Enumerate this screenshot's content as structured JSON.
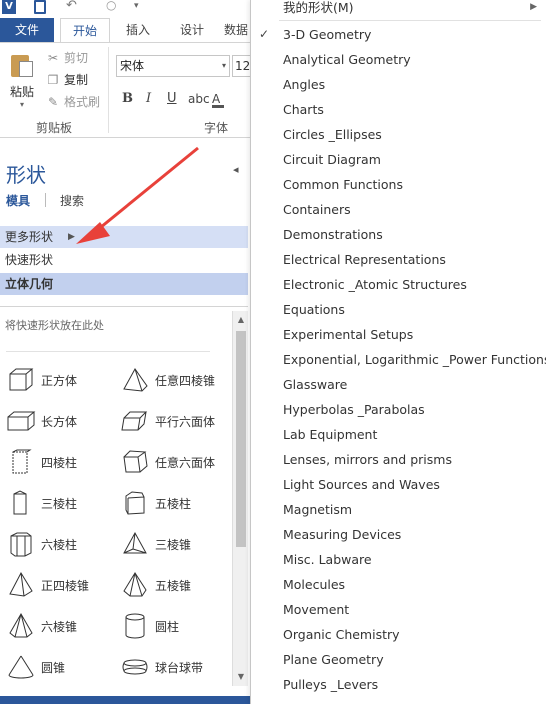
{
  "ribbon": {
    "tabs": [
      "文件",
      "开始",
      "插入",
      "设计",
      "数据"
    ],
    "clipboard": {
      "paste": "粘贴",
      "cut": "剪切",
      "copy": "复制",
      "format_painter": "格式刷",
      "group": "剪贴板"
    },
    "font": {
      "name": "宋体",
      "size": "12",
      "bold": "B",
      "italic": "I",
      "underline": "U",
      "abc": "abc",
      "color": "A",
      "group": "字体"
    }
  },
  "shapes_pane": {
    "title": "形状",
    "tab_stencil": "模具",
    "tab_search": "搜索",
    "more_shapes": "更多形状",
    "quick_shapes": "快速形状",
    "active_stencil": "立体几何",
    "drop_hint": "将快速形状放在此处",
    "shapes": [
      {
        "label": "正方体",
        "icon": "cube-icon"
      },
      {
        "label": "任意四棱锥",
        "icon": "quad-pyramid-icon"
      },
      {
        "label": "长方体",
        "icon": "cuboid-icon"
      },
      {
        "label": "平行六面体",
        "icon": "parallelepiped-icon"
      },
      {
        "label": "四棱柱",
        "icon": "quad-prism-icon"
      },
      {
        "label": "任意六面体",
        "icon": "hexahedron-icon"
      },
      {
        "label": "三棱柱",
        "icon": "tri-prism-icon"
      },
      {
        "label": "五棱柱",
        "icon": "penta-prism-icon"
      },
      {
        "label": "六棱柱",
        "icon": "hexa-prism-icon"
      },
      {
        "label": "三棱锥",
        "icon": "tri-pyramid-icon"
      },
      {
        "label": "正四棱锥",
        "icon": "regular-quad-pyramid-icon"
      },
      {
        "label": "五棱锥",
        "icon": "penta-pyramid-icon"
      },
      {
        "label": "六棱锥",
        "icon": "hexa-pyramid-icon"
      },
      {
        "label": "圆柱",
        "icon": "cylinder-icon"
      },
      {
        "label": "圆锥",
        "icon": "cone-icon"
      },
      {
        "label": "球台球带",
        "icon": "spherical-zone-icon"
      }
    ]
  },
  "menu": {
    "my_shapes": "我的形状(M)",
    "items": [
      {
        "label": "3-D Geometry",
        "checked": true
      },
      {
        "label": "Analytical Geometry"
      },
      {
        "label": "Angles"
      },
      {
        "label": "Charts"
      },
      {
        "label": "Circles _Ellipses"
      },
      {
        "label": "Circuit Diagram"
      },
      {
        "label": "Common Functions"
      },
      {
        "label": "Containers"
      },
      {
        "label": "Demonstrations"
      },
      {
        "label": "Electrical Representations"
      },
      {
        "label": "Electronic _Atomic Structures"
      },
      {
        "label": "Equations"
      },
      {
        "label": "Experimental Setups"
      },
      {
        "label": "Exponential, Logarithmic _Power Functions"
      },
      {
        "label": "Glassware"
      },
      {
        "label": "Hyperbolas _Parabolas"
      },
      {
        "label": "Lab Equipment"
      },
      {
        "label": "Lenses, mirrors and prisms"
      },
      {
        "label": "Light Sources and Waves"
      },
      {
        "label": "Magnetism"
      },
      {
        "label": "Measuring Devices"
      },
      {
        "label": "Misc. Labware"
      },
      {
        "label": "Molecules"
      },
      {
        "label": "Movement"
      },
      {
        "label": "Organic Chemistry"
      },
      {
        "label": "Plane Geometry"
      },
      {
        "label": "Pulleys _Levers"
      }
    ]
  },
  "colors": {
    "accent": "#2b579a",
    "selected_row": "#c2d0ee",
    "hover_row": "#d5dff5",
    "annotation_arrow": "#e8413a"
  }
}
